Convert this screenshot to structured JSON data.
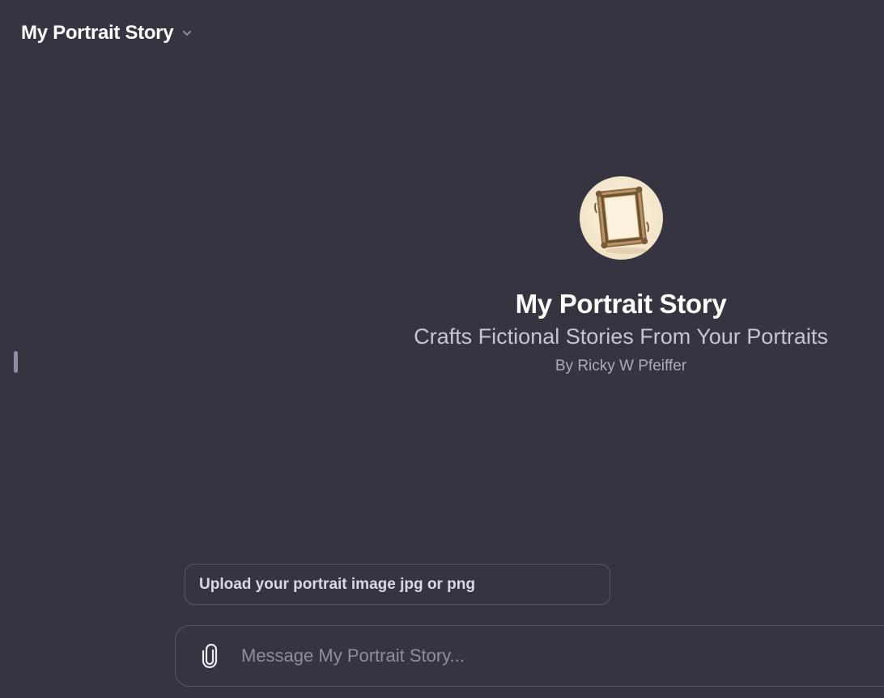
{
  "header": {
    "title": "My Portrait Story",
    "chevron_icon": "chevron-down-icon"
  },
  "gpt": {
    "name": "My Portrait Story",
    "description": "Crafts Fictional Stories From Your Portraits",
    "author": "By Ricky W Pfeiffer",
    "avatar_icon": "ornate-picture-frame"
  },
  "suggestions": [
    {
      "label": "Upload your portrait image jpg or png"
    }
  ],
  "composer": {
    "placeholder": "Message My Portrait Story...",
    "value": "",
    "attach_icon": "paperclip-icon"
  },
  "colors": {
    "background": "#343541",
    "border": "#565869",
    "text_primary": "#ffffff",
    "text_secondary": "#c5c5d2",
    "text_muted": "#8e8ea0"
  }
}
